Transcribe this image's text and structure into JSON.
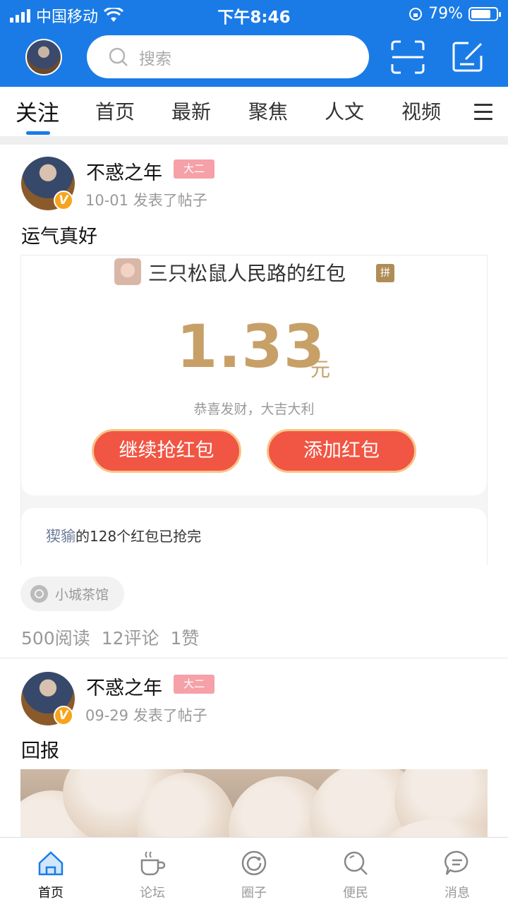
{
  "status": {
    "carrier": "中国移动",
    "time": "下午8:46",
    "battery": "79%",
    "battery_level": 0.79
  },
  "header": {
    "search_placeholder": "搜索"
  },
  "tabs": [
    "关注",
    "首页",
    "最新",
    "聚焦",
    "人文",
    "视频"
  ],
  "posts": [
    {
      "author": "不惑之年",
      "grade": "大二",
      "verified_badge": "V",
      "meta": "10-01 发表了帖子",
      "title": "运气真好",
      "red_packet": {
        "sender": "三只松鼠人民路的红包",
        "pin_label": "拼",
        "amount": "1.33",
        "unit": "元",
        "wish": "恭喜发财，大吉大利",
        "btn_continue": "继续抢红包",
        "btn_add": "添加红包",
        "footer_name": "猰貐",
        "footer_text": "的128个红包已抢完"
      },
      "circle_tag": "小城茶馆",
      "stats": {
        "reads": "500阅读",
        "comments": "12评论",
        "likes": "1赞"
      }
    },
    {
      "author": "不惑之年",
      "grade": "大二",
      "verified_badge": "V",
      "meta": "09-29 发表了帖子",
      "title": "回报"
    }
  ],
  "bottom_nav": [
    "首页",
    "论坛",
    "圈子",
    "便民",
    "消息"
  ],
  "colors": {
    "brand": "#1a7be6",
    "red_packet_gold": "#c7a068",
    "red_button": "#f15543"
  }
}
